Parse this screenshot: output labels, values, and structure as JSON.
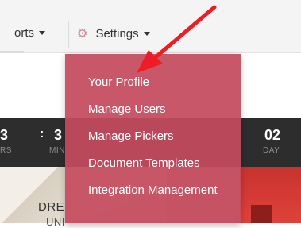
{
  "navbar": {
    "reports_label": "orts",
    "settings_label": "Settings",
    "settings_icon": "gear-icon"
  },
  "dropdown": {
    "items": [
      {
        "label": "Your Profile"
      },
      {
        "label": "Manage Users"
      },
      {
        "label": "Manage Pickers"
      },
      {
        "label": "Document Templates"
      },
      {
        "label": "Integration Management"
      }
    ]
  },
  "countdown": {
    "hours_value": "3",
    "hours_label": "RS",
    "minutes_value": "3",
    "minutes_label": "MIN",
    "colon": ":",
    "days_value": "02",
    "days_label": "DAY"
  },
  "banner": {
    "line1": "DRE",
    "line2": "UNI"
  },
  "colors": {
    "dropdown_bg": "#c44b5e",
    "navbar_bg": "#f4f4f4",
    "countdown_bg": "#2d2d2d",
    "annotation_arrow": "#ee1c24"
  }
}
